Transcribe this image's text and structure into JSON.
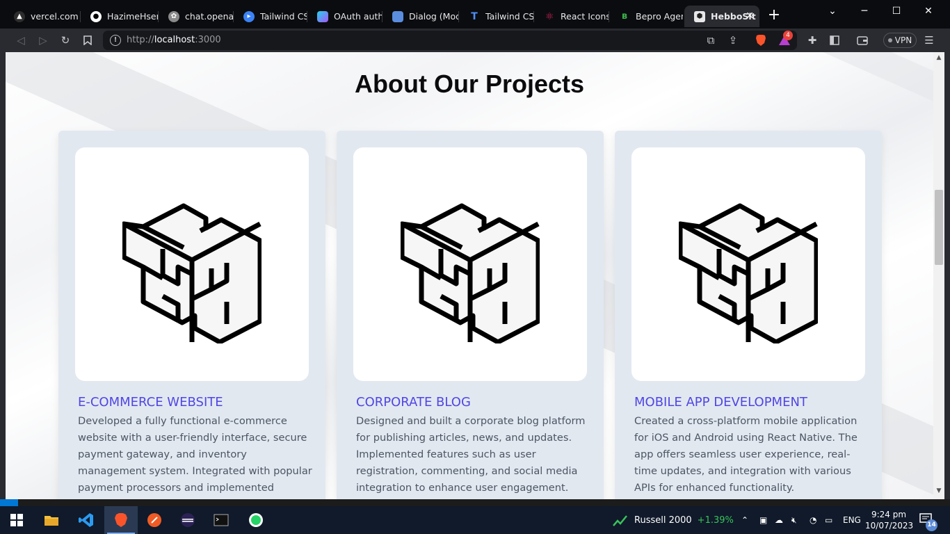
{
  "browser": {
    "tabs": [
      {
        "label": "vercel.com",
        "icon": "vercel-icon",
        "color": "#ffffff"
      },
      {
        "label": "HazimeHsen/",
        "icon": "github-icon",
        "color": "#ffffff"
      },
      {
        "label": "chat.openai.c",
        "icon": "openai-icon",
        "color": "#bfbfbf"
      },
      {
        "label": "Tailwind CSS",
        "icon": "headless-ui-icon",
        "color": "#3b82f6"
      },
      {
        "label": "OAuth auther",
        "icon": "shield-icon",
        "color": "#a855f7"
      },
      {
        "label": "Dialog (Moda",
        "icon": "mui-icon",
        "color": "#5a8de0"
      },
      {
        "label": "Tailwind CSS",
        "icon": "tailwind-elements-icon",
        "color": "#4f8ef7"
      },
      {
        "label": "React Icons",
        "icon": "react-icon",
        "color": "#e0245e"
      },
      {
        "label": "Bepro Agency",
        "icon": "bepro-icon",
        "color": "#3bb34a"
      }
    ],
    "active_tab": {
      "label": "HebboSit",
      "close": "✕"
    },
    "new_tab": "+",
    "url_host": "localhost",
    "url_prefix": "http://",
    "url_port": ":3000",
    "vpn_label": "VPN",
    "rewards_count": "4"
  },
  "page": {
    "heading": "About Our Projects",
    "accent_color": "#4f46e5",
    "projects": [
      {
        "title": "E-COMMERCE WEBSITE",
        "description": "Developed a fully functional e-commerce website with a user-friendly interface, secure payment gateway, and inventory management system. Integrated with popular payment processors and implemented advanced search"
      },
      {
        "title": "CORPORATE BLOG",
        "description": "Designed and built a corporate blog platform for publishing articles, news, and updates. Implemented features such as user registration, commenting, and social media integration to enhance user engagement."
      },
      {
        "title": "MOBILE APP DEVELOPMENT",
        "description": "Created a cross-platform mobile application for iOS and Android using React Native. The app offers seamless user experience, real-time updates, and integration with various APIs for enhanced functionality."
      }
    ]
  },
  "taskbar": {
    "ticker_name": "Russell 2000",
    "ticker_change": "+1.39%",
    "language": "ENG",
    "time": "9:24 pm",
    "date": "10/07/2023",
    "notification_count": "14"
  }
}
